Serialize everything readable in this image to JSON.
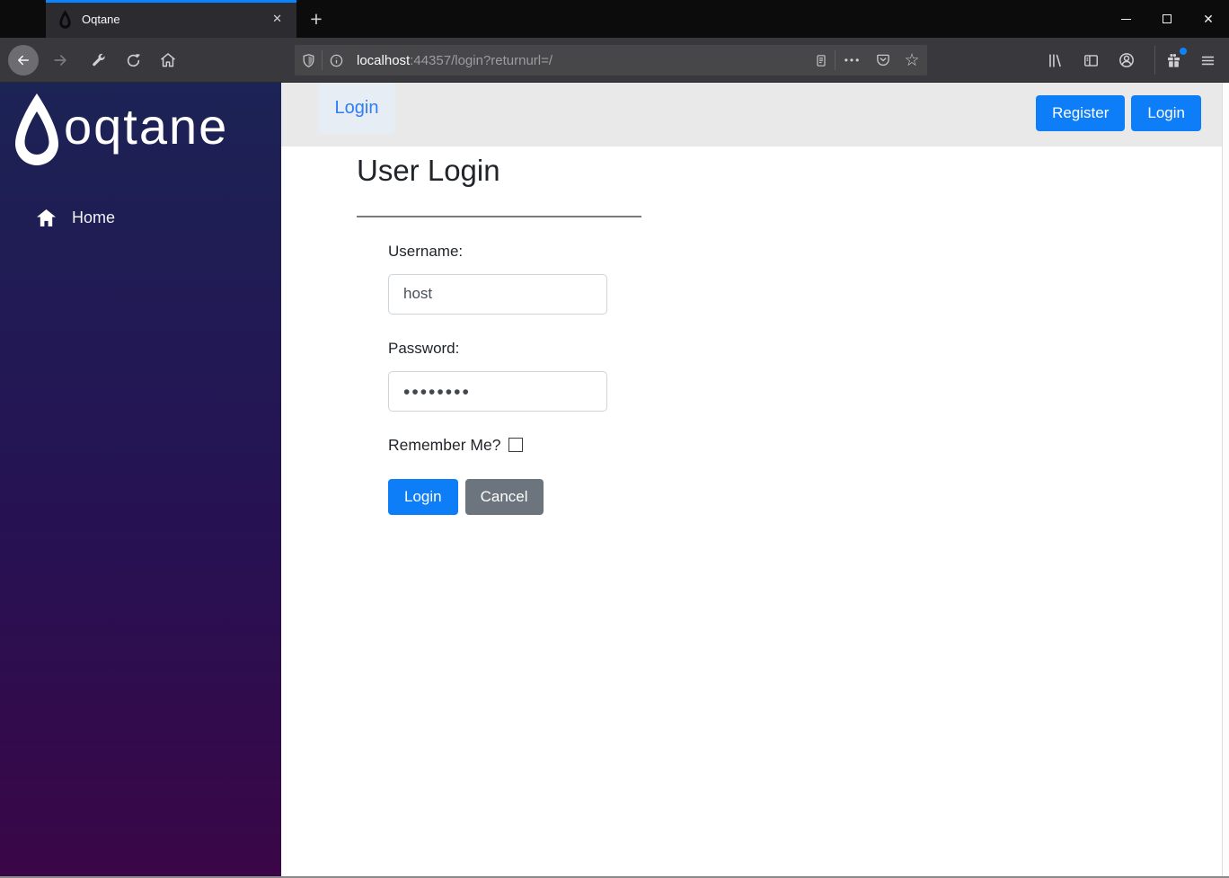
{
  "colors": {
    "primary": "#0d7df8",
    "secondary": "#6c757d",
    "link-blue": "#2e7cf6",
    "tab-accent": "#0a84ff",
    "sidebar-top": "#1c2355",
    "sidebar-bottom": "#3a0647",
    "header-bg": "#e9e9e9"
  },
  "browser": {
    "tab": {
      "title": "Oqtane",
      "close_icon": "✕",
      "new_tab_icon": "+"
    },
    "window_controls": {
      "close_icon": "✕"
    },
    "urlbar": {
      "host": "localhost",
      "path": ":44357/login?returnurl=/",
      "page_actions_icon": "•••",
      "bookmark_icon": "☆"
    }
  },
  "sidebar": {
    "logo_text": "oqtane",
    "items": [
      {
        "label": "Home"
      }
    ]
  },
  "header": {
    "nav_item": "Login",
    "register_button": "Register",
    "login_button": "Login"
  },
  "form": {
    "title": "User Login",
    "username_label": "Username:",
    "username_value": "host",
    "password_label": "Password:",
    "password_value": "••••••••",
    "remember_label": "Remember Me?",
    "login_button": "Login",
    "cancel_button": "Cancel"
  }
}
